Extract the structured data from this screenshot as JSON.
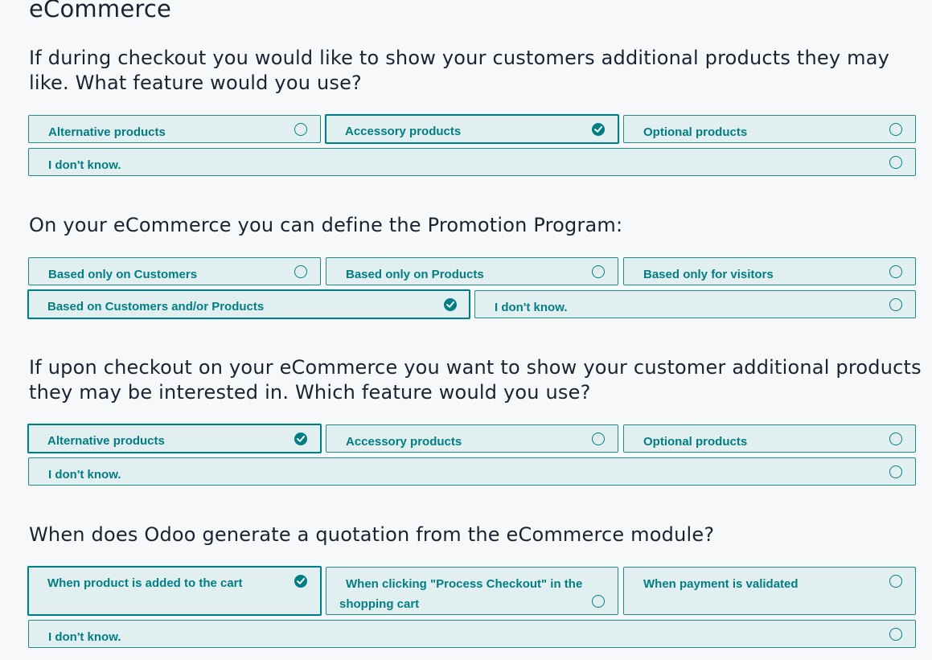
{
  "section": {
    "title": "eCommerce"
  },
  "questions": [
    {
      "text": "If during checkout you would like to show your customers additional products they may like. What feature would you use?",
      "options": [
        {
          "label": "Alternative products",
          "selected": false
        },
        {
          "label": "Accessory products",
          "selected": true
        },
        {
          "label": "Optional products",
          "selected": false
        },
        {
          "label": "I don't know.",
          "selected": false
        }
      ]
    },
    {
      "text": "On your eCommerce you can define the Promotion Program:",
      "options": [
        {
          "label": "Based only on Customers",
          "selected": false
        },
        {
          "label": "Based only on Products",
          "selected": false
        },
        {
          "label": "Based only for visitors",
          "selected": false
        },
        {
          "label": "Based on Customers and/or Products",
          "selected": true
        },
        {
          "label": "I don't know.",
          "selected": false
        }
      ]
    },
    {
      "text": "If upon checkout on your eCommerce you want to show your customer additional products they may be interested in. Which feature would you use?",
      "options": [
        {
          "label": "Alternative products",
          "selected": true
        },
        {
          "label": "Accessory products",
          "selected": false
        },
        {
          "label": "Optional products",
          "selected": false
        },
        {
          "label": "I don't know.",
          "selected": false
        }
      ]
    },
    {
      "text": "When does Odoo generate a quotation from the eCommerce module?",
      "options": [
        {
          "label": "When product is added to the cart",
          "selected": true
        },
        {
          "label": "When clicking \"Process Checkout\" in the shopping cart",
          "selected": false
        },
        {
          "label": "When payment is validated",
          "selected": false
        },
        {
          "label": "I don't know.",
          "selected": false
        }
      ]
    }
  ],
  "colors": {
    "accent": "#017e84",
    "option_bg": "#e2eff0",
    "title_text": "#1a2332",
    "page_bg": "#f6f8fa"
  },
  "icons": {
    "unselected": "radio-empty-icon",
    "selected": "check-circle-icon"
  }
}
